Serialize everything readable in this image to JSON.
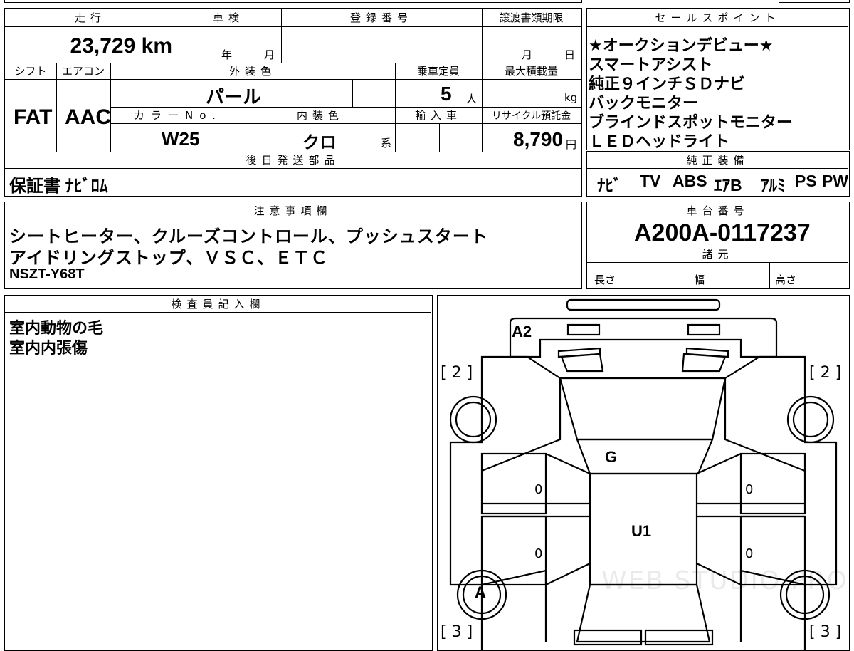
{
  "top": {
    "headers": {
      "mileage": "走行",
      "inspection": "車検",
      "registration": "登録番号",
      "transfer_deadline": "譲渡書類期限",
      "sales_points": "セールスポイント"
    },
    "mileage_value": "23,729 km",
    "year_label": "年",
    "month_label": "月",
    "transfer_month": "月",
    "transfer_day": "日"
  },
  "spec": {
    "headers": {
      "shift": "シフト",
      "aircon": "エアコン",
      "exterior_color": "外装色",
      "capacity": "乗車定員",
      "max_load": "最大積載量",
      "color_no": "カラーNo.",
      "interior_color": "内装色",
      "import": "輸入車",
      "recycle": "リサイクル預託金"
    },
    "shift_value": "FAT",
    "aircon_value": "AAC",
    "exterior_value": "パール",
    "capacity_value": "5",
    "capacity_unit": "人",
    "load_unit": "kg",
    "color_no_value": "W25",
    "interior_value": "クロ",
    "interior_suffix": "系",
    "recycle_value": "8,790",
    "recycle_unit": "円"
  },
  "sales_points": [
    "★オークションデビュー★",
    "スマートアシスト",
    "純正９インチＳＤナビ",
    "バックモニター",
    "ブラインドスポットモニター",
    "ＬＥＤヘッドライト"
  ],
  "later_parts": {
    "header": "後日発送部品",
    "value": "保証書 ﾅﾋﾞﾛﾑ"
  },
  "oem_equipment": {
    "header": "純正装備",
    "items": [
      "ﾅﾋﾞ",
      "TV",
      "ABS",
      "ｴｱB",
      "ｱﾙﾐ",
      "PS",
      "PW"
    ]
  },
  "notes": {
    "header": "注意事項欄",
    "lines": [
      "シートヒーター、クルーズコントロール、プッシュスタート",
      "アイドリングストップ、ＶＳＣ、ＥＴＣ",
      "NSZT-Y68T"
    ]
  },
  "chassis": {
    "header": "車台番号",
    "value": "A200A-0117237",
    "dims_header": "諸元",
    "length": "長さ",
    "width": "幅",
    "height": "高さ"
  },
  "inspector": {
    "header": "検査員記入欄",
    "lines": [
      "室内動物の毛",
      "室内内張傷"
    ]
  },
  "diagram": {
    "marks": {
      "front": "A2",
      "hood": "G",
      "roof": "U1",
      "wheel": "A"
    },
    "brackets": {
      "front_left": "[ 2 ]",
      "front_right": "[ 2 ]",
      "rear_left": "[ 3 ]",
      "rear_right": "[ 3 ]"
    },
    "zeros": [
      "0",
      "0",
      "0",
      "0"
    ],
    "watermark": "WEB STUDIO PRO"
  }
}
